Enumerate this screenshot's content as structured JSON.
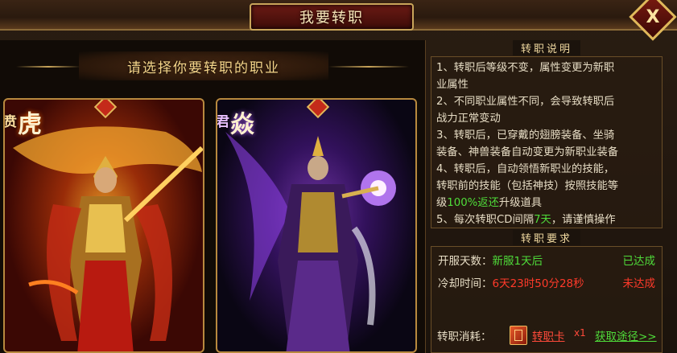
{
  "window": {
    "title": "我要转职",
    "close_label": "X"
  },
  "choose": {
    "heading": "请选择你要转职的职业"
  },
  "classes": [
    {
      "name_main": "虎",
      "name_sub": "贲",
      "theme": "warrior",
      "color": "#ff6a00"
    },
    {
      "name_main": "焱",
      "name_sub": "君",
      "theme": "mage",
      "color": "#b060ff"
    }
  ],
  "description": {
    "header": "转职说明",
    "lines": [
      "1、转职后等级不变，属性变更为新职",
      "业属性",
      "2、不同职业属性不同，会导致转职后",
      "战力正常变动",
      "3、转职后，已穿戴的翅膀装备、坐骑",
      "装备、神兽装备自动变更为新职业装备",
      "4、转职后，自动领悟新职业的技能，",
      "转职前的技能（包括神技）按照技能等"
    ],
    "line9_pre": "级",
    "line9_hl": "100%返还",
    "line9_post": "升级道具",
    "line10_pre": "5、每次转职CD间隔",
    "line10_hl": "7天",
    "line10_post": "，请谨慎操作"
  },
  "requirements": {
    "header": "转职要求",
    "items": [
      {
        "key": "开服天数：",
        "value": "新服1天后",
        "status": "已达成",
        "met": true
      },
      {
        "key": "冷却时间：",
        "value": "6天23时50分28秒",
        "status": "未达成",
        "met": false
      }
    ]
  },
  "cost": {
    "label": "转职消耗：",
    "item_name": "转职卡",
    "item_qty": "x1",
    "get_link": "获取途径>>",
    "icon": "job-change-card-icon"
  },
  "colors": {
    "accent_gold": "#c9a55a",
    "met_green": "#4fdc3a",
    "unmet_red": "#ff3a2a"
  }
}
